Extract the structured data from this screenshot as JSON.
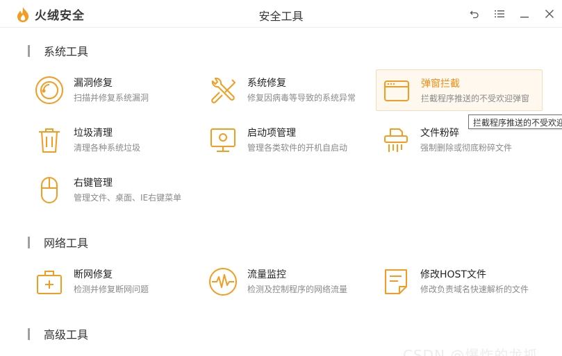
{
  "app": {
    "logo_text": "火绒安全",
    "window_title": "安全工具",
    "accent": "#f39c20"
  },
  "window_buttons": [
    {
      "icon": "back-icon"
    },
    {
      "icon": "menu-icon"
    },
    {
      "icon": "minimize-icon"
    },
    {
      "icon": "close-icon"
    }
  ],
  "sections": {
    "system": {
      "title": "系统工具",
      "tools": [
        {
          "name": "漏洞修复",
          "desc": "扫描并修复系统漏洞",
          "icon": "shield-patch-icon"
        },
        {
          "name": "系统修复",
          "desc": "修复因病毒等导致的系统异常",
          "icon": "wrench-screwdriver-icon"
        },
        {
          "name": "弹窗拦截",
          "desc": "拦截程序推送的不受欢迎弹窗",
          "icon": "popup-window-icon"
        },
        {
          "name": "垃圾清理",
          "desc": "清理各种系统垃圾",
          "icon": "trash-icon"
        },
        {
          "name": "启动项管理",
          "desc": "管理各类软件的开机自启动",
          "icon": "monitor-startup-icon"
        },
        {
          "name": "文件粉碎",
          "desc": "强制删除或彻底粉碎文件",
          "icon": "shredder-icon"
        },
        {
          "name": "右键管理",
          "desc": "管理文件、桌面、IE右键菜单",
          "icon": "mouse-icon"
        }
      ]
    },
    "network": {
      "title": "网络工具",
      "tools": [
        {
          "name": "断网修复",
          "desc": "检测并修复断网问题",
          "icon": "first-aid-kit-icon"
        },
        {
          "name": "流量监控",
          "desc": "检测及控制程序的网络流量",
          "icon": "traffic-wave-icon"
        },
        {
          "name": "修改HOST文件",
          "desc": "修改负责域名快速解析的文件",
          "icon": "document-edit-icon"
        }
      ]
    },
    "advanced": {
      "title": "高级工具"
    }
  },
  "tooltip": "拦截程序推送的不受欢迎",
  "watermark": "CSDN @爆炸的龙抓"
}
